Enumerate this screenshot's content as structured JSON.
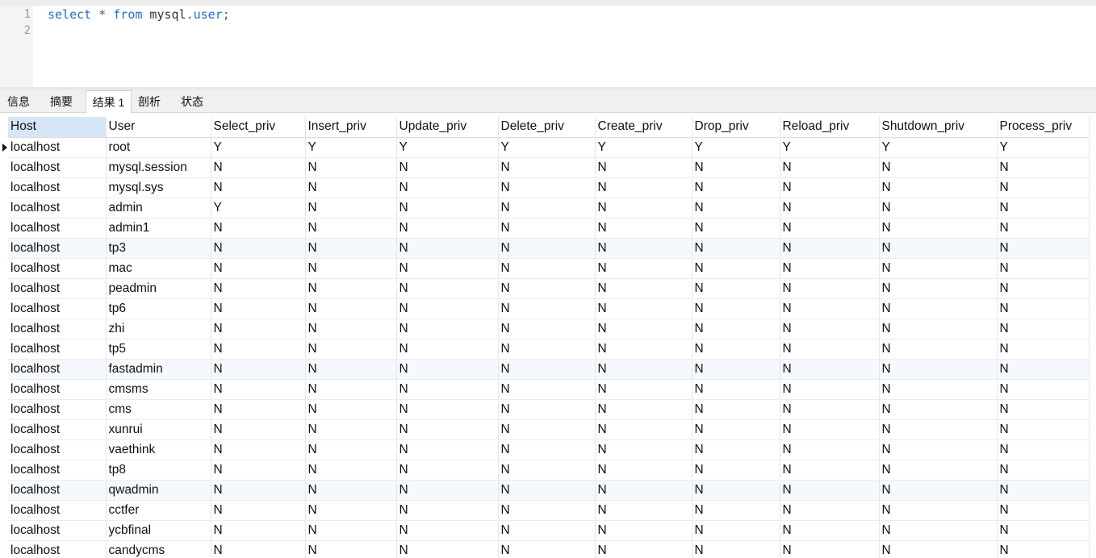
{
  "editor": {
    "line_numbers": [
      "1",
      "2"
    ],
    "query": {
      "kw1": "select",
      "star": " * ",
      "kw2": "from",
      "schema": " mysql",
      "dot": ".",
      "table": "user",
      "semi": ";"
    }
  },
  "tabs": [
    {
      "label": "信息"
    },
    {
      "label": "摘要"
    },
    {
      "label": "结果 1",
      "active": true
    },
    {
      "label": "剖析"
    },
    {
      "label": "状态"
    }
  ],
  "grid": {
    "columns": [
      "Host",
      "User",
      "Select_priv",
      "Insert_priv",
      "Update_priv",
      "Delete_priv",
      "Create_priv",
      "Drop_priv",
      "Reload_priv",
      "Shutdown_priv",
      "Process_priv"
    ],
    "sorted_column": "Host",
    "current_row": 0,
    "rows": [
      [
        "localhost",
        "root",
        "Y",
        "Y",
        "Y",
        "Y",
        "Y",
        "Y",
        "Y",
        "Y",
        "Y"
      ],
      [
        "localhost",
        "mysql.session",
        "N",
        "N",
        "N",
        "N",
        "N",
        "N",
        "N",
        "N",
        "N"
      ],
      [
        "localhost",
        "mysql.sys",
        "N",
        "N",
        "N",
        "N",
        "N",
        "N",
        "N",
        "N",
        "N"
      ],
      [
        "localhost",
        "admin",
        "Y",
        "N",
        "N",
        "N",
        "N",
        "N",
        "N",
        "N",
        "N"
      ],
      [
        "localhost",
        "admin1",
        "N",
        "N",
        "N",
        "N",
        "N",
        "N",
        "N",
        "N",
        "N"
      ],
      [
        "localhost",
        "tp3",
        "N",
        "N",
        "N",
        "N",
        "N",
        "N",
        "N",
        "N",
        "N"
      ],
      [
        "localhost",
        "mac",
        "N",
        "N",
        "N",
        "N",
        "N",
        "N",
        "N",
        "N",
        "N"
      ],
      [
        "localhost",
        "peadmin",
        "N",
        "N",
        "N",
        "N",
        "N",
        "N",
        "N",
        "N",
        "N"
      ],
      [
        "localhost",
        "tp6",
        "N",
        "N",
        "N",
        "N",
        "N",
        "N",
        "N",
        "N",
        "N"
      ],
      [
        "localhost",
        "zhi",
        "N",
        "N",
        "N",
        "N",
        "N",
        "N",
        "N",
        "N",
        "N"
      ],
      [
        "localhost",
        "tp5",
        "N",
        "N",
        "N",
        "N",
        "N",
        "N",
        "N",
        "N",
        "N"
      ],
      [
        "localhost",
        "fastadmin",
        "N",
        "N",
        "N",
        "N",
        "N",
        "N",
        "N",
        "N",
        "N"
      ],
      [
        "localhost",
        "cmsms",
        "N",
        "N",
        "N",
        "N",
        "N",
        "N",
        "N",
        "N",
        "N"
      ],
      [
        "localhost",
        "cms",
        "N",
        "N",
        "N",
        "N",
        "N",
        "N",
        "N",
        "N",
        "N"
      ],
      [
        "localhost",
        "xunrui",
        "N",
        "N",
        "N",
        "N",
        "N",
        "N",
        "N",
        "N",
        "N"
      ],
      [
        "localhost",
        "vaethink",
        "N",
        "N",
        "N",
        "N",
        "N",
        "N",
        "N",
        "N",
        "N"
      ],
      [
        "localhost",
        "tp8",
        "N",
        "N",
        "N",
        "N",
        "N",
        "N",
        "N",
        "N",
        "N"
      ],
      [
        "localhost",
        "qwadmin",
        "N",
        "N",
        "N",
        "N",
        "N",
        "N",
        "N",
        "N",
        "N"
      ],
      [
        "localhost",
        "cctfer",
        "N",
        "N",
        "N",
        "N",
        "N",
        "N",
        "N",
        "N",
        "N"
      ],
      [
        "localhost",
        "ycbfinal",
        "N",
        "N",
        "N",
        "N",
        "N",
        "N",
        "N",
        "N",
        "N"
      ],
      [
        "localhost",
        "candycms",
        "N",
        "N",
        "N",
        "N",
        "N",
        "N",
        "N",
        "N",
        "N"
      ]
    ]
  }
}
